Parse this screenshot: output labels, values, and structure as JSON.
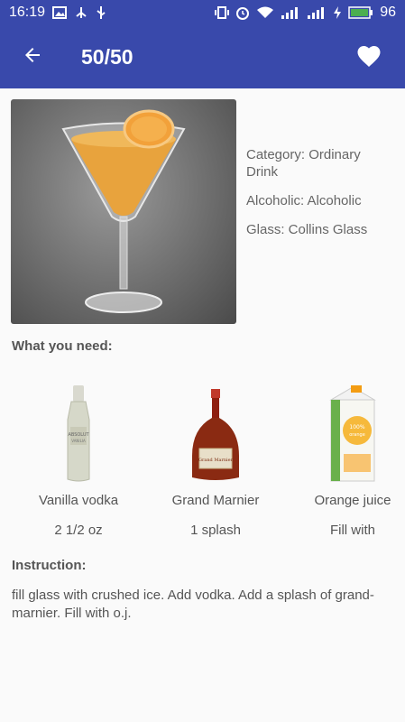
{
  "status_bar": {
    "time": "16:19",
    "battery": "96"
  },
  "app_bar": {
    "title": "50/50",
    "back_icon": "arrow-back-icon",
    "favorite_icon": "heart-icon"
  },
  "details": {
    "category": "Category: Ordinary Drink",
    "alcoholic": "Alcoholic: Alcoholic",
    "glass": "Glass: Collins Glass"
  },
  "what_you_need_label": "What you need:",
  "ingredients": [
    {
      "name": "Vanilla vodka",
      "measure": "2 1/2 oz",
      "icon": "vodka-bottle-icon"
    },
    {
      "name": "Grand Marnier",
      "measure": "1 splash",
      "icon": "liqueur-bottle-icon"
    },
    {
      "name": "Orange juice",
      "measure": "Fill with",
      "icon": "juice-carton-icon"
    }
  ],
  "instruction_label": "Instruction:",
  "instruction_text": "fill glass with crushed ice. Add vodka. Add a splash of grand-marnier. Fill with o.j.",
  "colors": {
    "primary": "#3949ab",
    "background": "#fafafa",
    "text": "#555555"
  }
}
